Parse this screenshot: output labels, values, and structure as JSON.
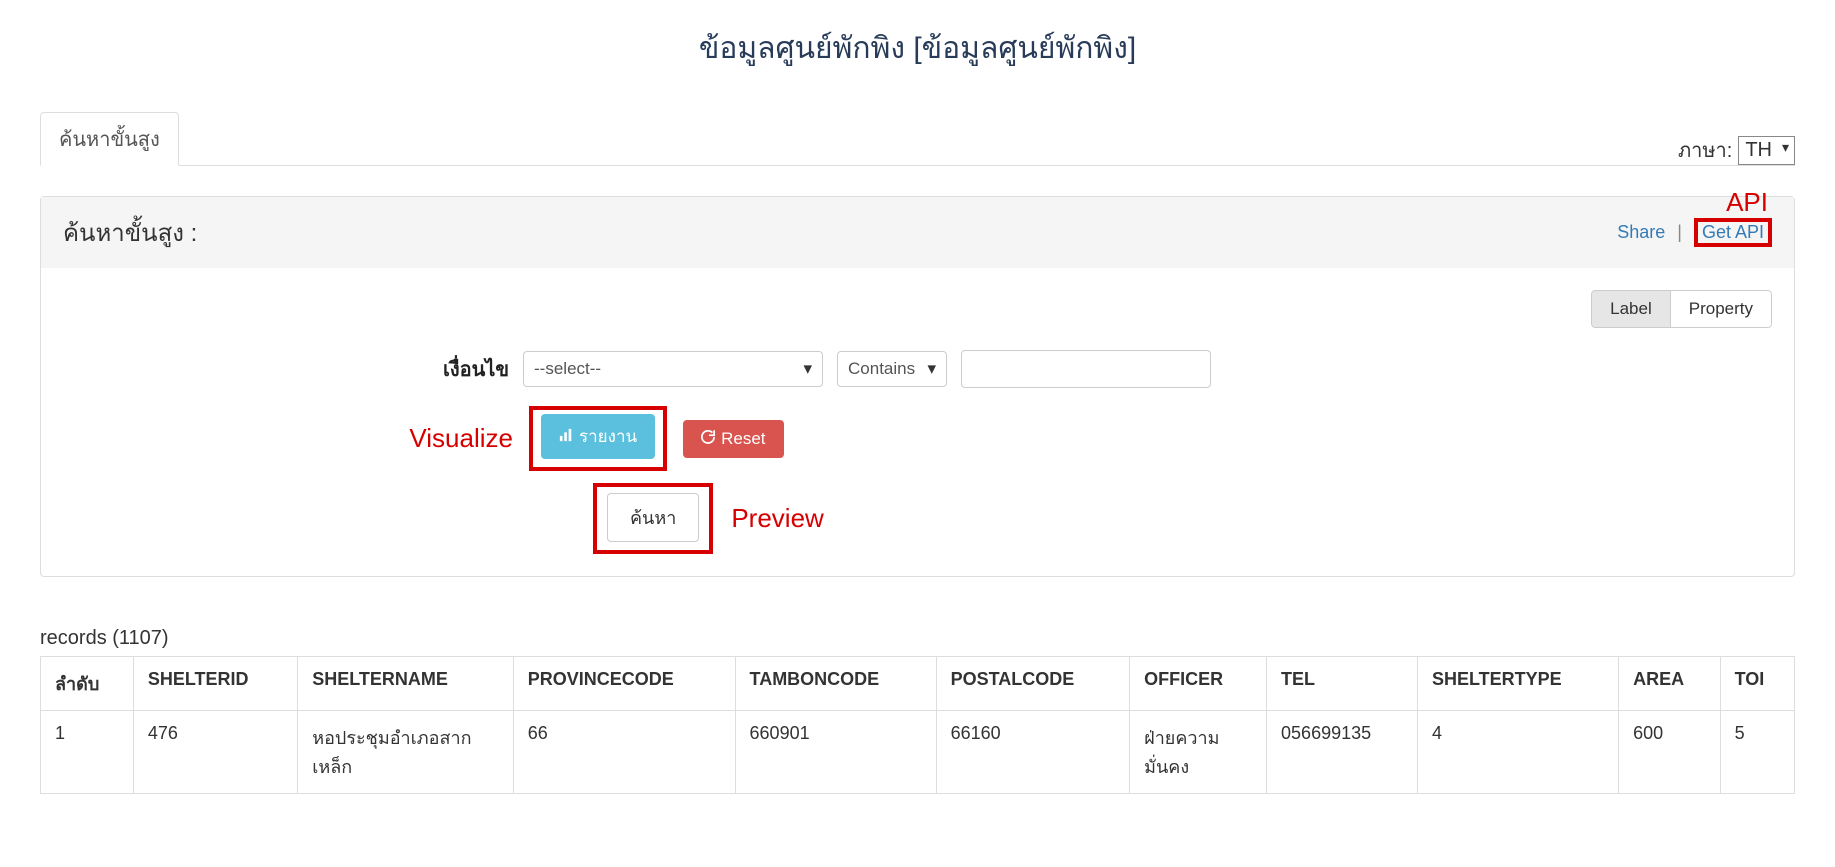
{
  "page_title": "ข้อมูลศูนย์พักพิง [ข้อมูลศูนย์พักพิง]",
  "tab_label": "ค้นหาขั้นสูง",
  "lang": {
    "label": "ภาษา:",
    "value": "TH"
  },
  "panel": {
    "title": "ค้นหาขั้นสูง :",
    "share": "Share",
    "get_api": "Get API"
  },
  "annotations": {
    "api": "API",
    "visualize": "Visualize",
    "preview": "Preview"
  },
  "toggle": {
    "label": "Label",
    "property": "Property"
  },
  "filter": {
    "condition_label": "เงื่อนไข",
    "field_select": "--select--",
    "op_select": "Contains",
    "value": ""
  },
  "buttons": {
    "report": "รายงาน",
    "reset": "Reset",
    "search": "ค้นหา"
  },
  "records_text": "records (1107)",
  "table": {
    "columns": [
      "ลำดับ",
      "SHELTERID",
      "SHELTERNAME",
      "PROVINCECODE",
      "TAMBONCODE",
      "POSTALCODE",
      "OFFICER",
      "TEL",
      "SHELTERTYPE",
      "AREA",
      "TOI"
    ],
    "rows": [
      {
        "idx": "1",
        "shelterid": "476",
        "sheltername": "หอประชุมอำเภอสากเหล็ก",
        "provincecode": "66",
        "tamboncode": "660901",
        "postalcode": "66160",
        "officer": "ฝ่ายความมั่นคง",
        "tel": "056699135",
        "sheltertype": "4",
        "area": "600",
        "toi": "5"
      }
    ]
  }
}
